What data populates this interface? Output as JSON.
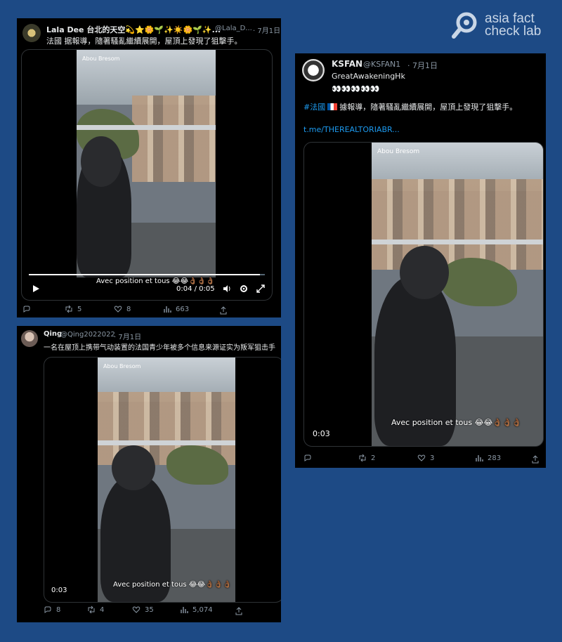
{
  "watermark": {
    "line1": "asia fact",
    "line2": "check lab"
  },
  "tweets": [
    {
      "name": "Lala Dee 台北的天空💫⭐🌼🌱✨☀️🌼🌱✨...",
      "handle": "@Lala_D...",
      "date": "· 7月1日",
      "text": "法國 据報導，隨著騷亂繼續展開，屋頂上發現了狙擊手。",
      "video": {
        "title": "Abou Bresom",
        "caption": "Avec position et tous 😂😂👌🏾👌🏾👌🏾",
        "time": "0:04 / 0:05",
        "progress": 0.98
      },
      "actions": {
        "replies": "",
        "retweets": "5",
        "likes": "8",
        "views": "663"
      }
    },
    {
      "name": "Qing",
      "handle": "@Qing2022022",
      "date": "· 7月1日",
      "text": "一名在屋顶上携带气动装置的法国青少年被多个信息来源证实为叛军狙击手",
      "video": {
        "title": "Abou Bresom",
        "caption": "Avec position et tous 😂😂👌🏾👌🏾👌🏾",
        "time": "0:03"
      },
      "actions": {
        "replies": "8",
        "retweets": "4",
        "likes": "35",
        "views": "5,074"
      }
    },
    {
      "name": "KSFAN",
      "handle": "@KSFAN1",
      "date": "· 7月1日",
      "line1": "GreatAwakeningHk",
      "line2": "👀👀👀👀👀",
      "hashtag": "#法國",
      "text": "據報導，隨著騷亂繼續展開，屋頂上發現了狙擊手。",
      "link": "t.me/THEREALTORIABR...",
      "video": {
        "title": "Abou Bresom",
        "caption": "Avec position et tous 😂😂👌🏾👌🏾👌🏾",
        "time": "0:03"
      },
      "actions": {
        "replies": "",
        "retweets": "2",
        "likes": "3",
        "views": "283"
      }
    }
  ]
}
